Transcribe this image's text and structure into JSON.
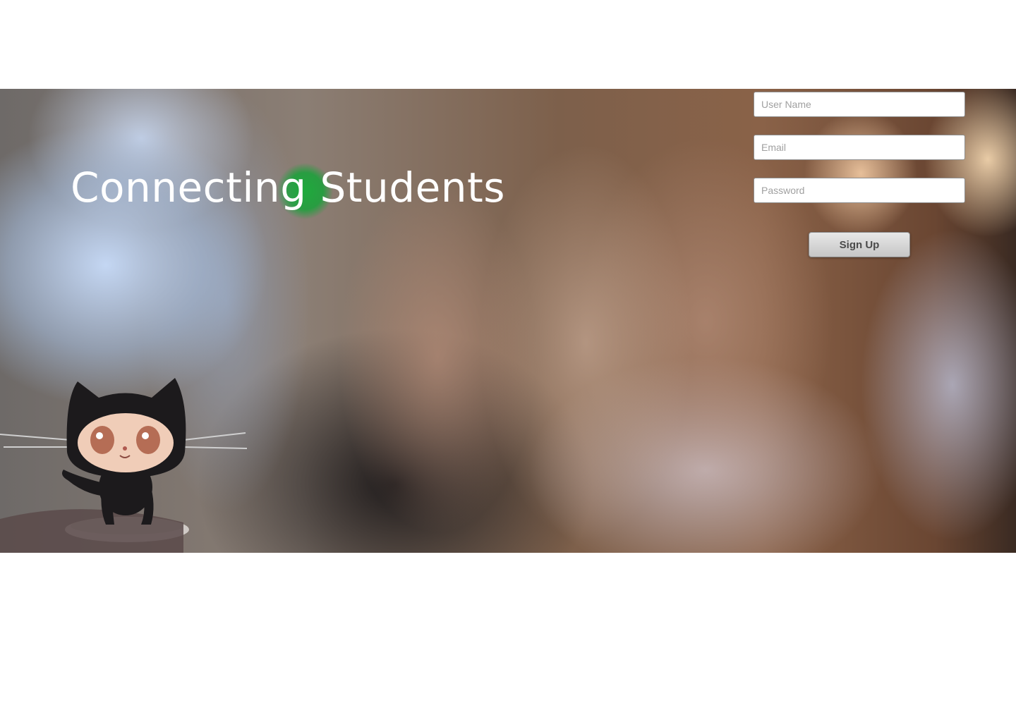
{
  "hero": {
    "title": "Connecting Students"
  },
  "form": {
    "username": {
      "placeholder": "User Name",
      "value": ""
    },
    "email": {
      "placeholder": "Email",
      "value": ""
    },
    "password": {
      "placeholder": "Password",
      "value": ""
    },
    "submit_label": "Sign Up"
  },
  "colors": {
    "title_text": "#ffffff",
    "green_spot": "#1ea03c",
    "button_bg": "#d6d6d6",
    "button_text": "#4a4a4a"
  },
  "icons": {
    "mascot": "octocat-figurine"
  }
}
